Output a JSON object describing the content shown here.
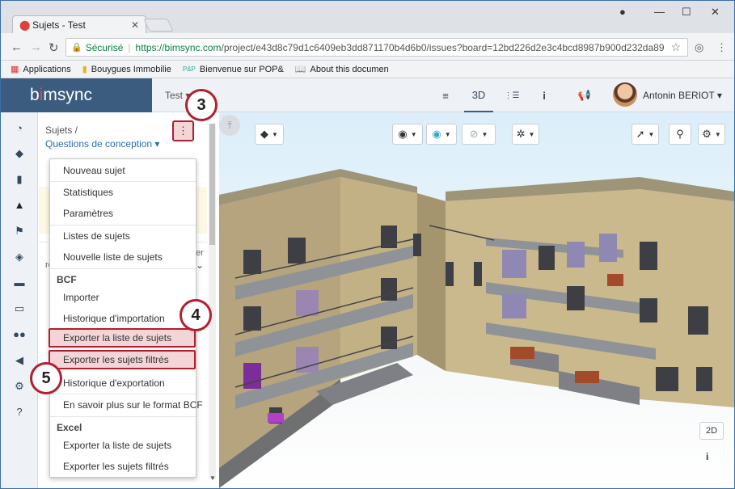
{
  "browser": {
    "tab_title": "Sujets - Test",
    "secure_label": "Sécurisé",
    "url_host": "https://bimsync.com",
    "url_rest": "/project/e43d8c79d1c6409eb3dd871170b4d6b0/issues?board=12bd226d2e3c4bcd8987b900d232da89",
    "bookmarks": [
      {
        "label": "Applications",
        "icon": "apps-grid-icon"
      },
      {
        "label": "Bouygues Immobilie",
        "icon": "folder-icon"
      },
      {
        "label": "Bienvenue sur POP&",
        "icon": "pop-icon"
      },
      {
        "label": "About this documen",
        "icon": "book-icon"
      }
    ]
  },
  "header": {
    "logo_text_a": "b",
    "logo_text_i": "i",
    "logo_text_b": "msync",
    "project_label": "Test ▾",
    "nav": [
      {
        "label": "≡",
        "icon": "list-icon"
      },
      {
        "label": "3D",
        "icon": "3d-label"
      },
      {
        "label": "⋮☰",
        "icon": "tree-icon"
      },
      {
        "label": "i",
        "icon": "info-icon"
      },
      {
        "label": "📢",
        "icon": "megaphone-icon"
      }
    ],
    "user_name": "Antonin BERIOT ▾"
  },
  "panel": {
    "crumb_root": "Sujets /",
    "crumb_board": "Questions de conception ▾",
    "bottom_text": "ré",
    "bottom_right": "er"
  },
  "menu": {
    "items_group1": [
      "Nouveau sujet",
      "Statistiques",
      "Paramètres"
    ],
    "items_group2": [
      "Listes de sujets",
      "Nouvelle liste de sujets"
    ],
    "bcf_header": "BCF",
    "bcf_items": [
      "Importer",
      "Historique d'importation",
      "Exporter la liste de sujets",
      "Exporter les sujets filtrés",
      "Historique d'exportation"
    ],
    "bcf_learn": "En savoir plus sur le format BCF",
    "excel_header": "Excel",
    "excel_items": [
      "Exporter la liste de sujets",
      "Exporter les sujets filtrés"
    ]
  },
  "badges": {
    "step3": "3",
    "step4": "4",
    "step5": "5"
  },
  "viewer": {
    "btn_2d": "2D",
    "btn_info": "i"
  },
  "colors": {
    "accent": "#3b5b7f",
    "highlight_border": "#b21f2d",
    "highlight_fill": "#f3d5d8",
    "link": "#2d6db5"
  }
}
